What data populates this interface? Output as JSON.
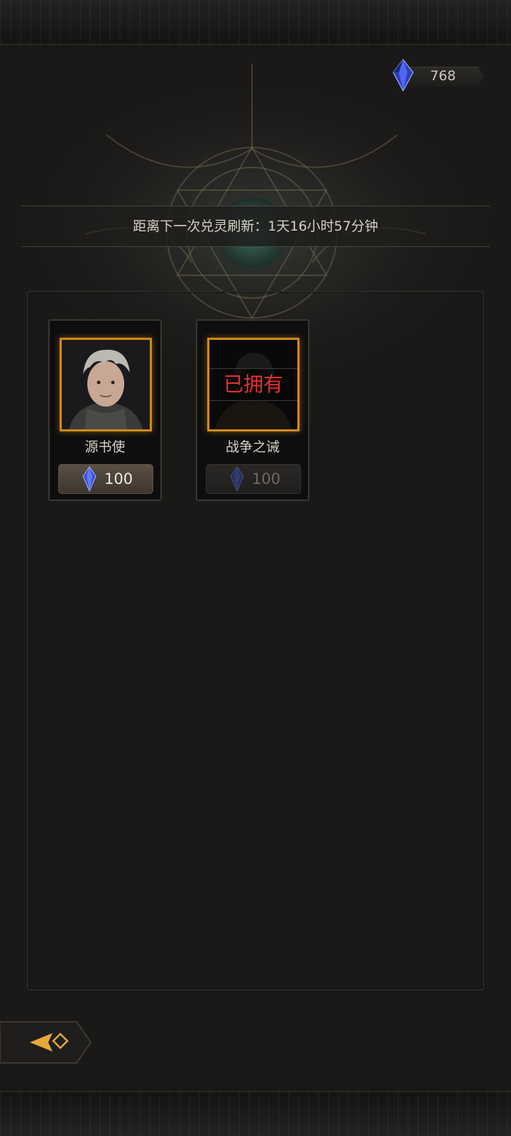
{
  "currency": {
    "icon": "blue-crystal-icon",
    "amount": "768"
  },
  "refresh": {
    "text": "距离下一次兑灵刷新：1天16小时57分钟"
  },
  "cards": [
    {
      "name": "源书使",
      "price": "100",
      "owned": false,
      "price_icon": "blue-crystal-icon"
    },
    {
      "name": "战争之诫",
      "price": "100",
      "owned": true,
      "owned_label": "已拥有",
      "price_icon": "blue-crystal-icon"
    }
  ],
  "navigation": {
    "back_icon": "back-arrow-icon"
  },
  "colors": {
    "frame_gold": "#d08a1c",
    "owned_red": "#e2322c",
    "crystal_blue": "#3b4fd8"
  }
}
